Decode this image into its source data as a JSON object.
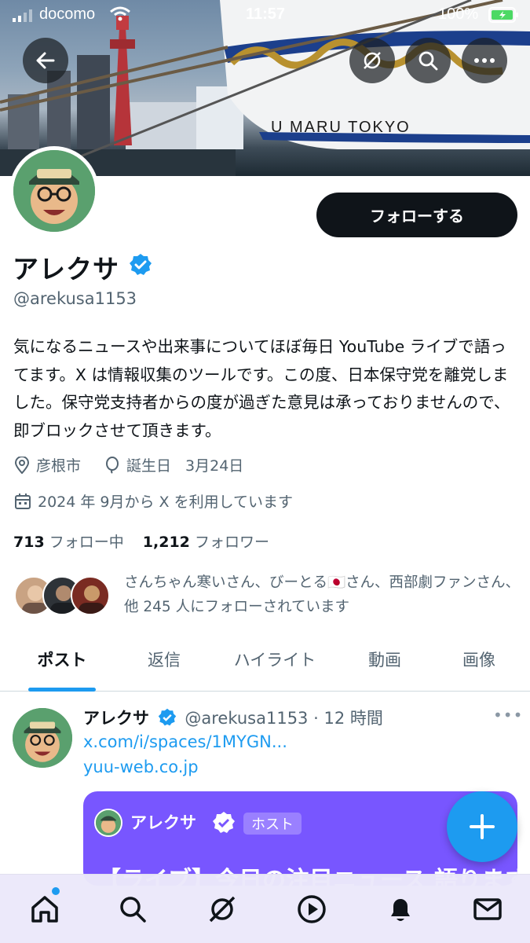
{
  "status_bar": {
    "carrier": "docomo",
    "time": "11:57",
    "battery": "100%"
  },
  "banner": {
    "ship_text": "U MARU  TOKYO"
  },
  "profile": {
    "name": "アレクサ",
    "handle": "@arekusa1153",
    "follow_label": "フォローする",
    "bio": "気になるニュースや出来事についてほぼ毎日 YouTube ライブで語ってます。X は情報収集のツールです。この度、日本保守党を離党しました。保守党支持者からの度が過ぎた意見は承っておりませんので、即ブロックさせて頂きます。",
    "location": "彦根市",
    "birthday_label": "誕生日",
    "birthday": "3月24日",
    "joined": "2024 年 9月から X を利用しています",
    "following_count": "713",
    "following_label": "フォロー中",
    "followers_count": "1,212",
    "followers_label": "フォロワー",
    "followed_by": "さんちゃん寒いさん、びーとる🇯🇵さん、西部劇ファンさん、他 245 人にフォローされています"
  },
  "tabs": [
    {
      "label": "ポスト",
      "active": true
    },
    {
      "label": "返信",
      "active": false
    },
    {
      "label": "ハイライト",
      "active": false
    },
    {
      "label": "動画",
      "active": false
    },
    {
      "label": "画像",
      "active": false
    }
  ],
  "post": {
    "name": "アレクサ",
    "handle": "@arekusa1153",
    "time": "· 12 時間",
    "link1": "x.com/i/spaces/1MYGN...",
    "link2": "yuu-web.co.jp",
    "space_host_name": "アレクサ",
    "space_host_badge": "ホスト",
    "space_title": "【ライブ】今日の注目ニュース 語ります"
  },
  "icons": {
    "back": "back-arrow-icon",
    "grok": "grok-icon",
    "search": "search-icon",
    "more": "more-icon",
    "location": "location-pin-icon",
    "birthday": "balloon-icon",
    "calendar": "calendar-icon",
    "fab": "plus-icon"
  },
  "colors": {
    "accent": "#1d9bf0",
    "space_purple": "#7856ff",
    "text_secondary": "#536471"
  }
}
